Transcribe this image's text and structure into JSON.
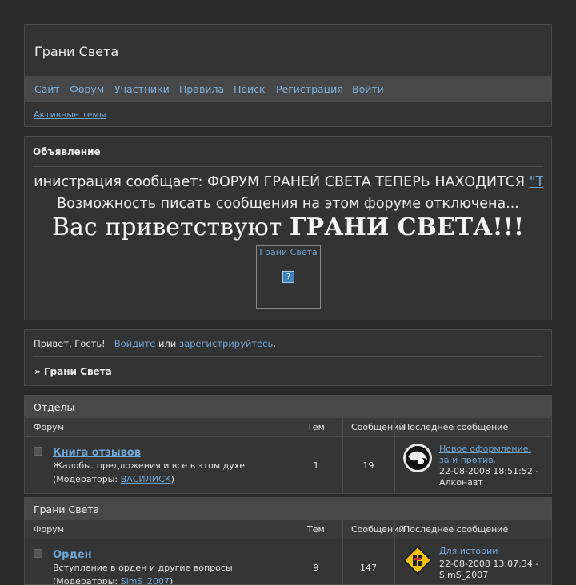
{
  "header": {
    "site_title": "Грани Света",
    "nav": [
      "Сайт",
      "Форум",
      "Участники",
      "Правила",
      "Поиск",
      "Регистрация",
      "Войти"
    ],
    "active_topics": "Активные темы"
  },
  "announcement": {
    "title": "Объявление",
    "marquee_text": "Администрация сообщает: ФОРУМ ГРАНЕЙ СВЕТА ТЕПЕРЬ НАХОДИТСЯ ",
    "marquee_link": "\"ТУТ\"",
    "disabled_text": "Возможность писать сообщения на этом форуме отключена...",
    "welcome_prefix": "Вас приветствуют ",
    "welcome_bold": "ГРАНИ СВЕТА!!!",
    "image_alt": "Грани Света"
  },
  "greeting": {
    "hello": "Привет, Гость!",
    "login_link": "Войдите",
    "or": "или",
    "register_link": "зарегистрируйтесь",
    "period": ".",
    "breadcrumb": "» Грани Света"
  },
  "columns": {
    "forum": "Форум",
    "topics": "Тем",
    "posts": "Сообщений",
    "last_post": "Последнее сообщение"
  },
  "categories": [
    {
      "name": "Отделы",
      "forum": {
        "name": "Книга отзывов",
        "description": "Жалобы. предложения и все в этом духе",
        "mods_prefix": "(Модераторы: ",
        "mods": "ВАСИЛИСК",
        "mods_suffix": ")",
        "topics": "1",
        "posts": "19",
        "last_title": "Новое оформление, за и против.",
        "last_date": "22-08-2008 18:51:52 -",
        "last_author": "Алконавт"
      }
    },
    {
      "name": "Грани Света",
      "forum": {
        "name": "Орден",
        "description": "Вступление в орден и другие вопросы",
        "mods_prefix": "(Модераторы: ",
        "mods": "SimS_2007",
        "mods_suffix": ")",
        "topics": "9",
        "posts": "147",
        "last_title": "Для истории",
        "last_date": "22-08-2008 13:07:34 -",
        "last_author": "SimS_2007"
      }
    }
  ],
  "colors": {
    "background": "#2a2a2a",
    "panel": "#333333",
    "nav_bar": "#484848",
    "link": "#6ea6d8"
  }
}
